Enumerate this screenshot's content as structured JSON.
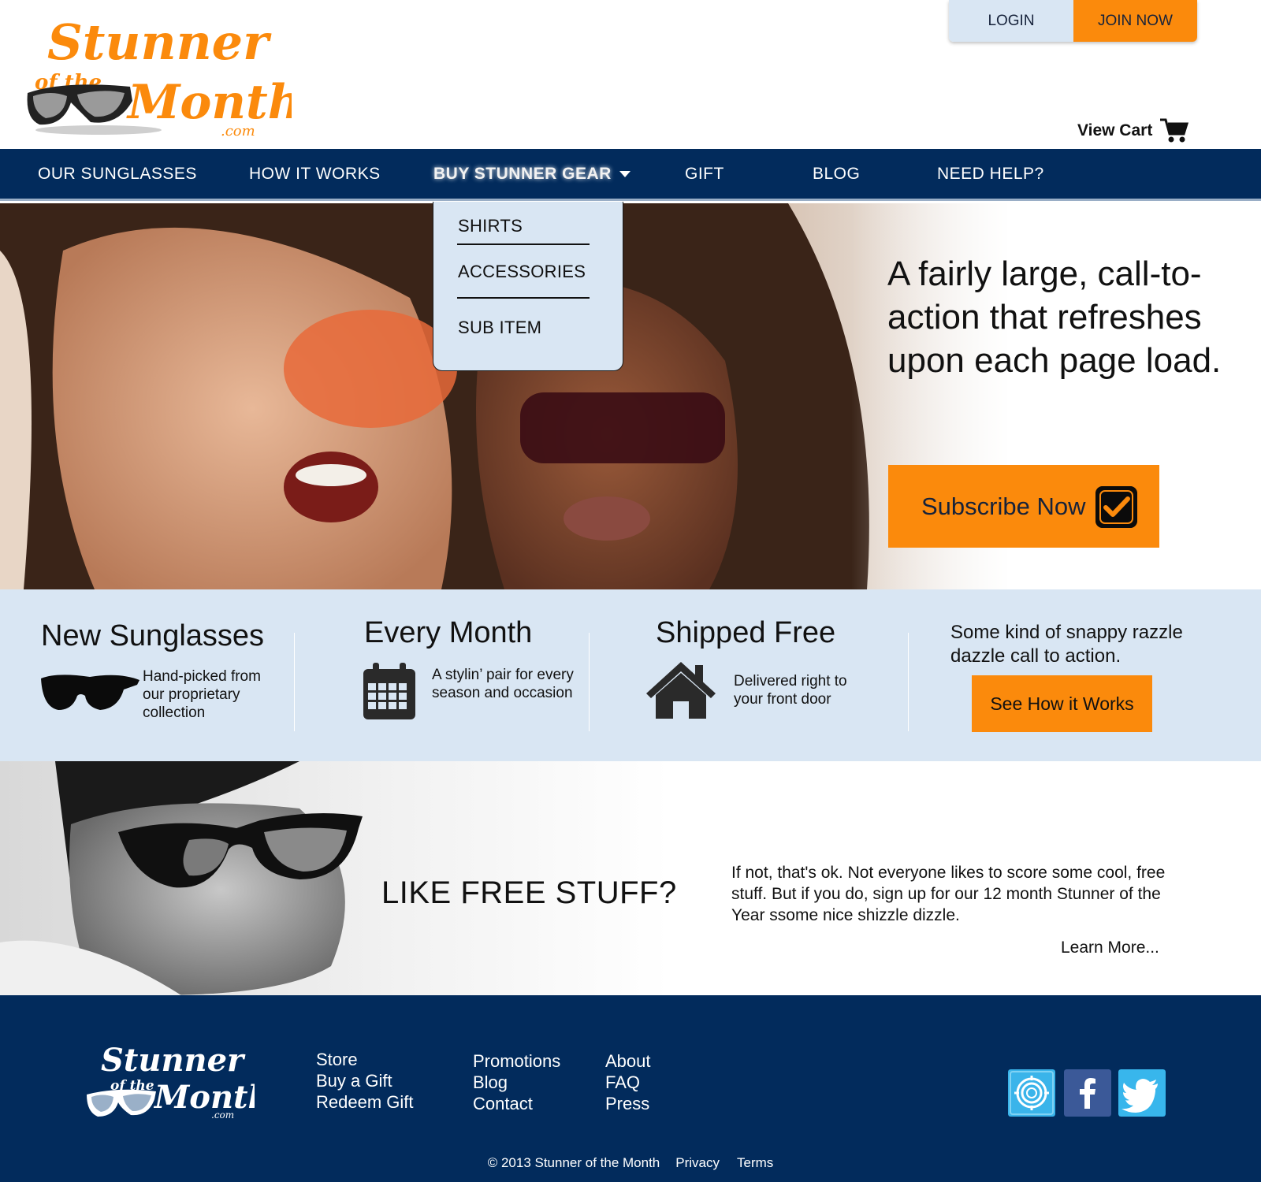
{
  "brand": {
    "logo_line1": "Stunner",
    "logo_line2": "of the",
    "logo_line3": "Month",
    "logo_suffix": ".com",
    "orange": "#fb8a0c",
    "navy": "#022b5c",
    "light_blue": "#d9e6f3"
  },
  "header": {
    "login_label": "LOGIN",
    "join_label": "JOIN NOW",
    "cart_label": "View Cart",
    "cart_icon": "shopping-cart-icon"
  },
  "nav": {
    "items": [
      {
        "label": "OUR SUNGLASSES"
      },
      {
        "label": "HOW IT WORKS"
      },
      {
        "label": "BUY STUNNER GEAR",
        "active": true
      },
      {
        "label": "GIFT"
      },
      {
        "label": "BLOG"
      },
      {
        "label": "NEED HELP?"
      }
    ],
    "dropdown": [
      "SHIRTS",
      "ACCESSORIES",
      "SUB ITEM"
    ]
  },
  "hero": {
    "headline": "A fairly large, call-to-action that refreshes upon each page load.",
    "cta_label": "Subscribe Now",
    "cta_icon": "checkbox-checked-icon"
  },
  "features": [
    {
      "title": "New Sunglasses",
      "desc": "Hand-picked from our proprietary collection",
      "icon": "sunglasses-icon"
    },
    {
      "title": "Every Month",
      "desc": "A stylin’ pair for every season and occasion",
      "icon": "calendar-icon"
    },
    {
      "title": "Shipped Free",
      "desc": "Delivered right to your front door",
      "icon": "house-icon"
    },
    {
      "title": "",
      "desc": "Some kind of snappy razzle dazzle call to action.",
      "button": "See How it Works"
    }
  ],
  "free": {
    "title": "LIKE FREE STUFF?",
    "text": "If not, that's ok. Not everyone likes to score some cool, free stuff. But if you do, sign up for our 12 month Stunner of the Year ssome nice shizzle dizzle.",
    "learn_more": "Learn More..."
  },
  "footer": {
    "col1": [
      "Store",
      "Buy a Gift",
      "Redeem Gift"
    ],
    "col2": [
      "Promotions",
      "Blog",
      "Contact"
    ],
    "col3": [
      "About",
      "FAQ",
      "Press"
    ],
    "social": [
      {
        "icon": "lifebuoy-icon",
        "color": "#3ab4ea"
      },
      {
        "icon": "facebook-icon",
        "color": "#3b5998"
      },
      {
        "icon": "twitter-icon",
        "color": "#38b6ec"
      }
    ],
    "copyright": "© 2013 Stunner of the Month",
    "privacy": "Privacy",
    "terms": "Terms"
  }
}
